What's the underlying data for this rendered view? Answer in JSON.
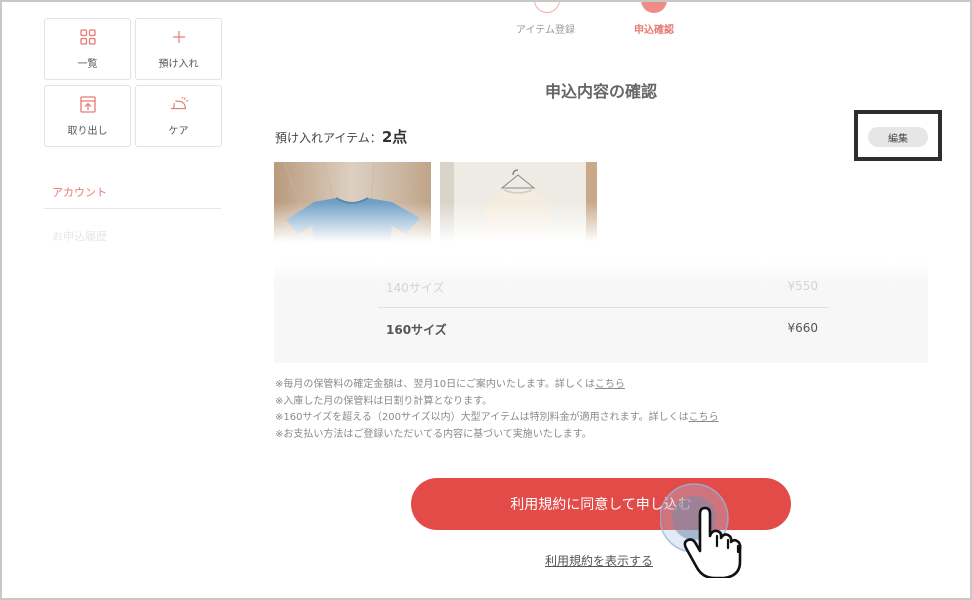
{
  "sidebar": {
    "tiles": [
      {
        "label": "一覧",
        "icon": "grid-icon"
      },
      {
        "label": "預け入れ",
        "icon": "plus-icon"
      },
      {
        "label": "取り出し",
        "icon": "box-out-icon"
      },
      {
        "label": "ケア",
        "icon": "iron-icon"
      }
    ],
    "account_label": "アカウント",
    "history_label": "お申込履歴"
  },
  "steps": {
    "item_register": "アイテム登録",
    "confirm": "申込確認"
  },
  "page_title": "申込内容の確認",
  "deposit": {
    "label": "預け入れアイテム：",
    "count": "2点",
    "edit_label": "編集"
  },
  "prices": [
    {
      "size": "140サイズ",
      "price": "¥550"
    },
    {
      "size": "160サイズ",
      "price": "¥660"
    }
  ],
  "notes": {
    "line1": "※毎月の保管料の確定金額は、翌月10日にご案内いたします。詳しくは",
    "line1_link": "こちら",
    "line2": "※入庫した月の保管料は日割り計算となります。",
    "line3": "※160サイズを超える（200サイズ以内）大型アイテムは特別料金が適用されます。詳しくは",
    "line3_link": "こちら",
    "line4": "※お支払い方法はご登録いただいてる内容に基づいて実施いたします。"
  },
  "cta_label": "利用規約に同意して申し込む",
  "terms_link": "利用規約を表示する",
  "colors": {
    "accent": "#e24b47",
    "accent_light": "#f08c86",
    "muted": "#8a8a8a"
  }
}
